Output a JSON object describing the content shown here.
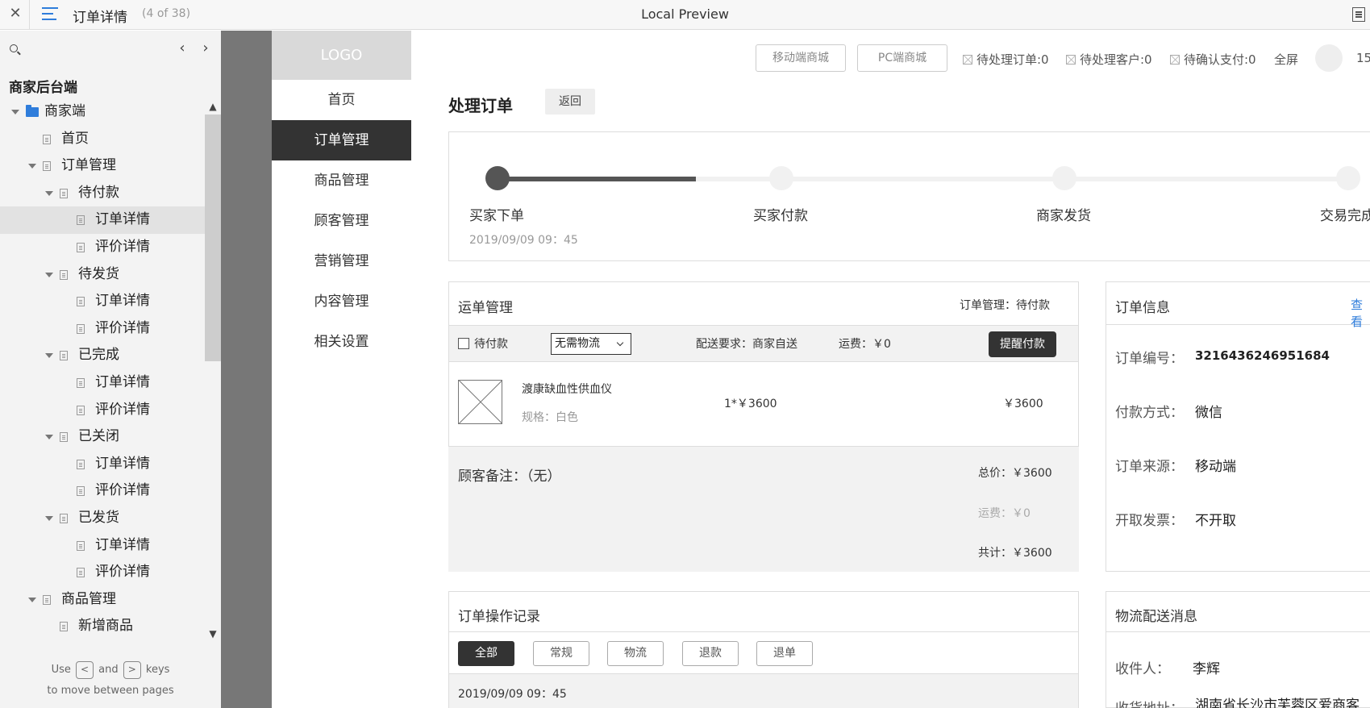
{
  "topbar": {
    "close": "✕",
    "page_title": "订单详情",
    "page_count": "(4 of 38)",
    "center_title": "Local Preview"
  },
  "sidebar": {
    "project": "商家后台端",
    "prev": "‹",
    "next": "›",
    "scroll_up": "▲",
    "scroll_down": "▼",
    "tree": [
      {
        "label": "商家端",
        "kind": "folder",
        "level": 0,
        "expanded": true
      },
      {
        "label": "首页",
        "kind": "page",
        "level": 1
      },
      {
        "label": "订单管理",
        "kind": "page",
        "level": 1,
        "expanded": true
      },
      {
        "label": "待付款",
        "kind": "page",
        "level": 2,
        "expanded": true
      },
      {
        "label": "订单详情",
        "kind": "page",
        "level": 3,
        "active": true
      },
      {
        "label": "评价详情",
        "kind": "page",
        "level": 3
      },
      {
        "label": "待发货",
        "kind": "page",
        "level": 2,
        "expanded": true
      },
      {
        "label": "订单详情",
        "kind": "page",
        "level": 3
      },
      {
        "label": "评价详情",
        "kind": "page",
        "level": 3
      },
      {
        "label": "已完成",
        "kind": "page",
        "level": 2,
        "expanded": true
      },
      {
        "label": "订单详情",
        "kind": "page",
        "level": 3
      },
      {
        "label": "评价详情",
        "kind": "page",
        "level": 3
      },
      {
        "label": "已关闭",
        "kind": "page",
        "level": 2,
        "expanded": true
      },
      {
        "label": "订单详情",
        "kind": "page",
        "level": 3
      },
      {
        "label": "评价详情",
        "kind": "page",
        "level": 3
      },
      {
        "label": "已发货",
        "kind": "page",
        "level": 2,
        "expanded": true
      },
      {
        "label": "订单详情",
        "kind": "page",
        "level": 3
      },
      {
        "label": "评价详情",
        "kind": "page",
        "level": 3
      },
      {
        "label": "商品管理",
        "kind": "page",
        "level": 1,
        "expanded": true
      },
      {
        "label": "新增商品",
        "kind": "page",
        "level": 2
      }
    ],
    "hint_use": "Use",
    "hint_and": "and",
    "hint_keys": "keys",
    "hint_line2": "to move between pages",
    "key_prev": "<",
    "key_next": ">"
  },
  "nav": {
    "logo": "LOGO",
    "items": [
      "首页",
      "订单管理",
      "商品管理",
      "顾客管理",
      "营销管理",
      "内容管理",
      "相关设置"
    ],
    "active_index": 1
  },
  "header": {
    "mobile_mall": "移动端商城",
    "pc_mall": "PC端商城",
    "pending_orders": "待处理订单:0",
    "pending_customers": "待处理客户:0",
    "pending_payments": "待确认支付:0",
    "fullscreen": "全屏",
    "user_number": "15"
  },
  "page": {
    "title": "处理订单",
    "back": "返回"
  },
  "progress": {
    "steps": [
      "买家下单",
      "买家付款",
      "商家发货",
      "交易完成"
    ],
    "completed": 1,
    "time": "2019/09/09 09：45"
  },
  "shipping": {
    "title": "运单管理",
    "status": "订单管理：待付款",
    "checkbox_label": "待付款",
    "logistics_option": "无需物流",
    "delivery_req": "配送要求：商家自送",
    "freight": "运费：￥0",
    "remind_button": "提醒付款",
    "product": {
      "name": "渡康缺血性供血仪",
      "spec": "规格：白色",
      "qty_price": "1*￥3600",
      "total": "￥3600"
    },
    "remark": "顾客备注：（无）",
    "sum_total": "总价：￥3600",
    "sum_freight": "运费：￥0",
    "sum_all": "共计：￥3600"
  },
  "order_info": {
    "title": "订单信息",
    "link": "查看",
    "rows": [
      {
        "key": "订单编号：",
        "value": "3216436246951684"
      },
      {
        "key": "付款方式：",
        "value": "微信"
      },
      {
        "key": "订单来源：",
        "value": "移动端"
      },
      {
        "key": "开取发票：",
        "value": "不开取"
      }
    ]
  },
  "op_log": {
    "title": "订单操作记录",
    "tabs": [
      "全部",
      "常规",
      "物流",
      "退款",
      "退单"
    ],
    "active_tab": 0,
    "first_time": "2019/09/09 09：45"
  },
  "logistics": {
    "title": "物流配送消息",
    "receiver_key": "收件人：",
    "receiver": "李辉",
    "address_key": "收货地址：",
    "address": "湖南省长沙市芙蓉区爱商客"
  }
}
